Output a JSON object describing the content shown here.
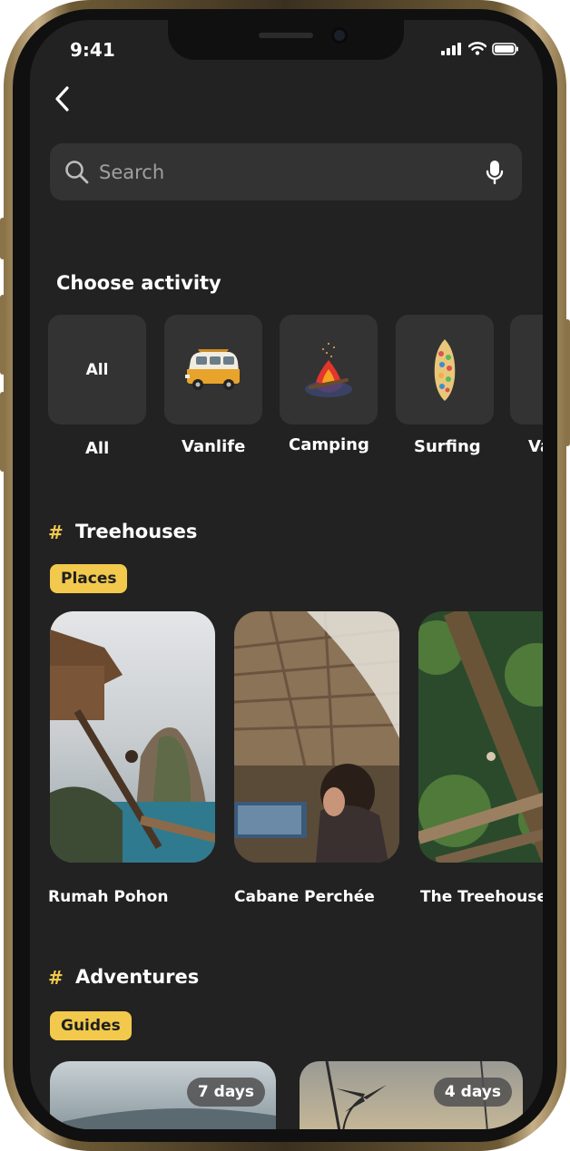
{
  "status": {
    "time": "9:41"
  },
  "search": {
    "placeholder": "Search"
  },
  "activities": {
    "title": "Choose activity",
    "items": [
      {
        "tile_text": "All",
        "label": "All",
        "icon": "all"
      },
      {
        "label": "Vanlife",
        "icon": "campervan-icon"
      },
      {
        "label": "Camping",
        "icon": "campfire-icon"
      },
      {
        "label": "Surfing",
        "icon": "surfboard-icon"
      },
      {
        "label": "Va",
        "icon": "unknown"
      }
    ]
  },
  "treehouses": {
    "hash": "#",
    "title": "Treehouses",
    "tag": "Places",
    "places": [
      {
        "name": "Rumah Pohon"
      },
      {
        "name": "Cabane Perchée"
      },
      {
        "name": "The Treehouse"
      }
    ]
  },
  "adventures": {
    "hash": "#",
    "title": "Adventures",
    "tag": "Guides",
    "guides": [
      {
        "duration": "7 days"
      },
      {
        "duration": "4 days"
      }
    ]
  },
  "colors": {
    "accent": "#f2c94c",
    "background": "#222222",
    "tile": "#333333"
  }
}
